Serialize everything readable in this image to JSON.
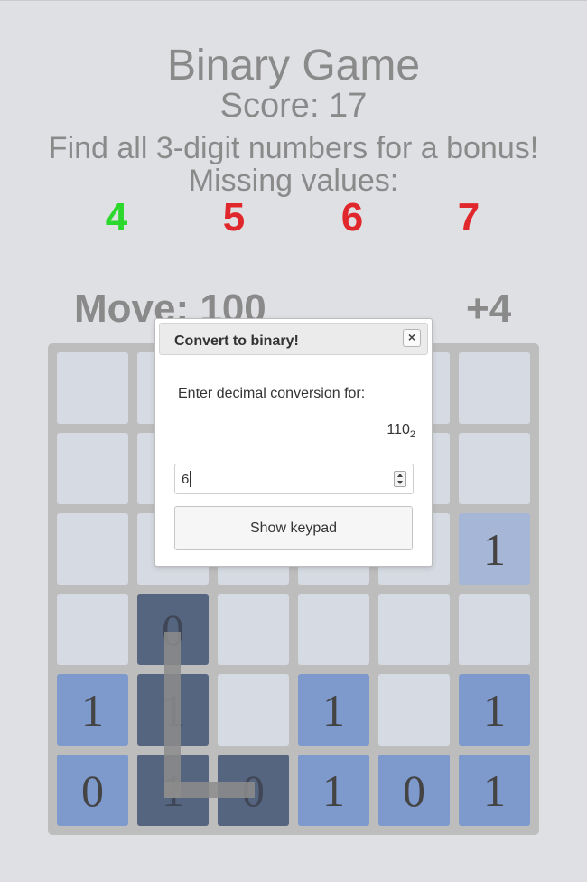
{
  "game": {
    "title": "Binary Game",
    "score_text": "Score: 17",
    "bonus_text": "Find all 3-digit numbers for a bonus!",
    "missing_label": "Missing values:",
    "missing_values": [
      {
        "value": "4",
        "color": "#2bd82b"
      },
      {
        "value": "5",
        "color": "#e0282c"
      },
      {
        "value": "6",
        "color": "#e0282c"
      },
      {
        "value": "7",
        "color": "#e0282c"
      }
    ],
    "move_text": "Move: 100",
    "plus_text": "+4"
  },
  "board": {
    "rows": [
      [
        {
          "d": "",
          "s": "off"
        },
        {
          "d": "",
          "s": "off"
        },
        {
          "d": "",
          "s": "off"
        },
        {
          "d": "",
          "s": "off"
        },
        {
          "d": "",
          "s": "off"
        },
        {
          "d": "",
          "s": "off"
        }
      ],
      [
        {
          "d": "",
          "s": "off"
        },
        {
          "d": "",
          "s": "off"
        },
        {
          "d": "",
          "s": "off"
        },
        {
          "d": "",
          "s": "off"
        },
        {
          "d": "",
          "s": "off"
        },
        {
          "d": "",
          "s": "off"
        }
      ],
      [
        {
          "d": "",
          "s": "off"
        },
        {
          "d": "",
          "s": "off"
        },
        {
          "d": "",
          "s": "off"
        },
        {
          "d": "",
          "s": "off"
        },
        {
          "d": "",
          "s": "off"
        },
        {
          "d": "1",
          "s": "light"
        }
      ],
      [
        {
          "d": "",
          "s": "off"
        },
        {
          "d": "0",
          "s": "path"
        },
        {
          "d": "",
          "s": "off"
        },
        {
          "d": "",
          "s": "off"
        },
        {
          "d": "",
          "s": "off"
        },
        {
          "d": "",
          "s": "off"
        }
      ],
      [
        {
          "d": "1",
          "s": "on"
        },
        {
          "d": "1",
          "s": "path"
        },
        {
          "d": "",
          "s": "off"
        },
        {
          "d": "1",
          "s": "on"
        },
        {
          "d": "",
          "s": "off"
        },
        {
          "d": "1",
          "s": "on"
        }
      ],
      [
        {
          "d": "0",
          "s": "on"
        },
        {
          "d": "1",
          "s": "path"
        },
        {
          "d": "0",
          "s": "path"
        },
        {
          "d": "1",
          "s": "on"
        },
        {
          "d": "0",
          "s": "on"
        },
        {
          "d": "1",
          "s": "on"
        }
      ]
    ]
  },
  "dialog": {
    "title": "Convert to binary!",
    "close_label": "×",
    "prompt": "Enter decimal conversion for:",
    "binary_number": "110",
    "base": "2",
    "input_value": "6",
    "keypad_label": "Show keypad"
  }
}
